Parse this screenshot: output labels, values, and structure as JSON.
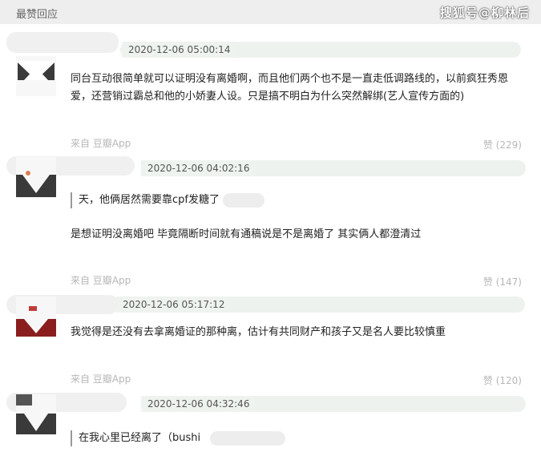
{
  "header": {
    "title": "最赞回应",
    "watermark": "搜狐号@柳林后"
  },
  "comments": [
    {
      "time": "2020-12-06 05:00:14",
      "body": "同台互动很简单就可以证明没有离婚啊，而且他们两个也不是一直走低调路线的，以前疯狂秀恩爱，还营销过霸总和他的小娇妻人设。只是搞不明白为什么突然解绑(艺人宣传方面的)",
      "from": "来自 豆瓣App",
      "likes": "赞 (229)"
    },
    {
      "time": "2020-12-06 04:02:16",
      "quote": "天，他俩居然需要靠cpf发糖了",
      "body": "是想证明没离婚吧 毕竟隔断时间就有通稿说是不是离婚了 其实俩人都澄清过",
      "from": "来自 豆瓣App",
      "likes": "赞 (147)"
    },
    {
      "time": "2020-12-06 05:17:12",
      "body": "我觉得是还没有去拿离婚证的那种离，估计有共同财产和孩子又是名人要比较慎重",
      "from": "来自 豆瓣App",
      "likes": "赞 (120)"
    },
    {
      "time": "2020-12-06 04:32:46",
      "quote": "在我心里已经离了（bushi"
    }
  ]
}
